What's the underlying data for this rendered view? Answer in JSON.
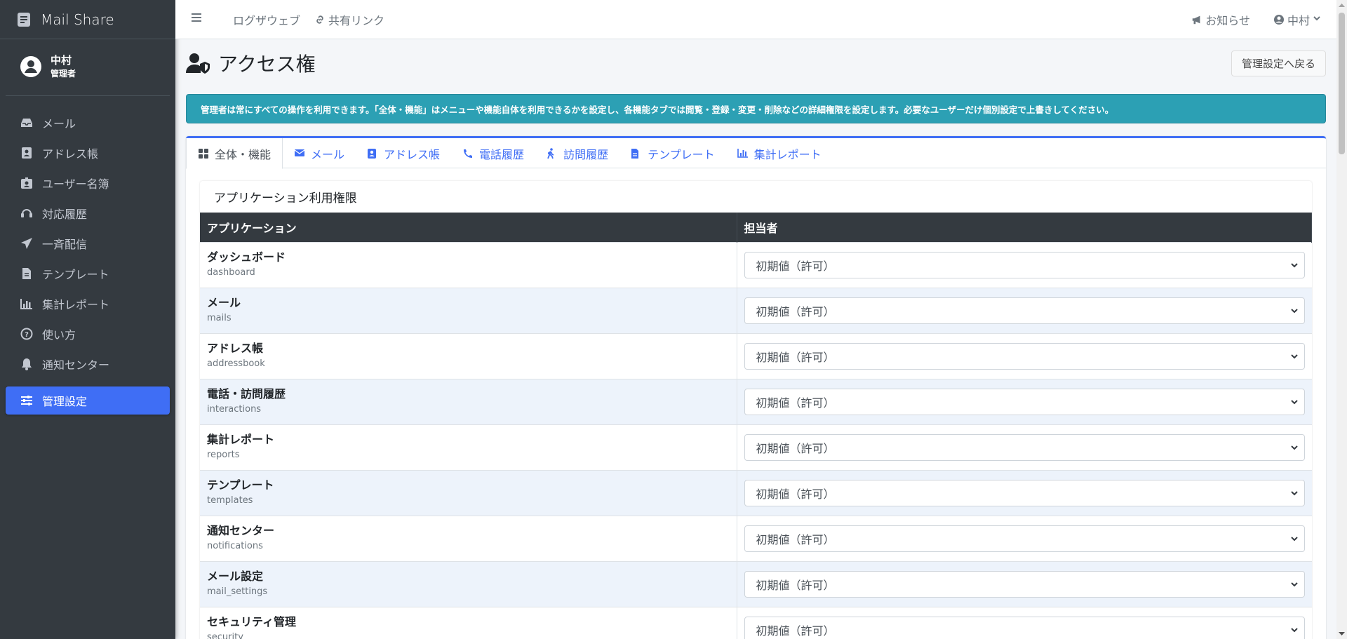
{
  "brand": {
    "name": "Mail Share"
  },
  "user": {
    "name": "中村",
    "role": "管理者"
  },
  "sidebar": {
    "items": [
      {
        "label": "メール",
        "icon": "inbox-icon"
      },
      {
        "label": "アドレス帳",
        "icon": "address-book-icon"
      },
      {
        "label": "ユーザー名簿",
        "icon": "id-badge-icon"
      },
      {
        "label": "対応履歴",
        "icon": "headset-icon"
      },
      {
        "label": "一斉配信",
        "icon": "paper-plane-icon"
      },
      {
        "label": "テンプレート",
        "icon": "file-icon"
      },
      {
        "label": "集計レポート",
        "icon": "chart-icon"
      },
      {
        "label": "使い方",
        "icon": "question-circle-icon"
      },
      {
        "label": "通知センター",
        "icon": "bell-icon"
      },
      {
        "label": "管理設定",
        "icon": "sliders-icon",
        "active": true
      }
    ]
  },
  "topbar": {
    "links": [
      {
        "label": "ログザウェブ"
      },
      {
        "label": "共有リンク"
      }
    ],
    "notice_label": "お知らせ",
    "user_label": "中村"
  },
  "page": {
    "title": "アクセス権",
    "back_button": "管理設定へ戻る",
    "alert": "管理者は常にすべての操作を利用できます。「全体・機能」はメニューや機能自体を利用できるかを設定し、各機能タブでは閲覧・登録・変更・削除などの詳細権限を設定します。必要なユーザーだけ個別設定で上書きしてください。"
  },
  "tabs": [
    {
      "label": "全体・機能",
      "icon": "grid-icon",
      "active": true
    },
    {
      "label": "メール",
      "icon": "envelope-icon"
    },
    {
      "label": "アドレス帳",
      "icon": "address-book-icon"
    },
    {
      "label": "電話履歴",
      "icon": "phone-icon"
    },
    {
      "label": "訪問履歴",
      "icon": "walking-icon"
    },
    {
      "label": "テンプレート",
      "icon": "file-icon"
    },
    {
      "label": "集計レポート",
      "icon": "chart-icon"
    }
  ],
  "permissions": {
    "heading": "アプリケーション利用権限",
    "columns": [
      "アプリケーション",
      "担当者"
    ],
    "rows": [
      {
        "name": "ダッシュボード",
        "key": "dashboard",
        "value": "初期値（許可）"
      },
      {
        "name": "メール",
        "key": "mails",
        "value": "初期値（許可）"
      },
      {
        "name": "アドレス帳",
        "key": "addressbook",
        "value": "初期値（許可）"
      },
      {
        "name": "電話・訪問履歴",
        "key": "interactions",
        "value": "初期値（許可）"
      },
      {
        "name": "集計レポート",
        "key": "reports",
        "value": "初期値（許可）"
      },
      {
        "name": "テンプレート",
        "key": "templates",
        "value": "初期値（許可）"
      },
      {
        "name": "通知センター",
        "key": "notifications",
        "value": "初期値（許可）"
      },
      {
        "name": "メール設定",
        "key": "mail_settings",
        "value": "初期値（許可）"
      },
      {
        "name": "セキュリティ管理",
        "key": "security",
        "value": "初期値（許可）"
      }
    ]
  },
  "colors": {
    "accent": "#3f6ef5",
    "sidebar_bg": "#343a40",
    "alert_bg": "#2ca0b4",
    "table_head": "#343a40"
  }
}
